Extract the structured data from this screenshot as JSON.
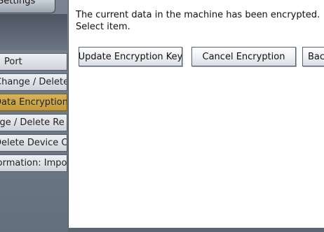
{
  "left_panel": {
    "settings_tab_label": "Settings",
    "items": [
      {
        "label": "Port"
      },
      {
        "label": "Change / Delete"
      },
      {
        "label": "Data Encryption"
      },
      {
        "label": "Change / Delete Re"
      },
      {
        "label": "Delete Device C"
      },
      {
        "label": "Information: Impor"
      }
    ]
  },
  "dialog": {
    "message_line1": "The current data in the machine has been encrypted.",
    "message_line2": "Select item.",
    "buttons": {
      "update_encryption_key": "Update Encryption Key",
      "cancel_encryption": "Cancel Encryption",
      "back": "Back"
    }
  }
}
